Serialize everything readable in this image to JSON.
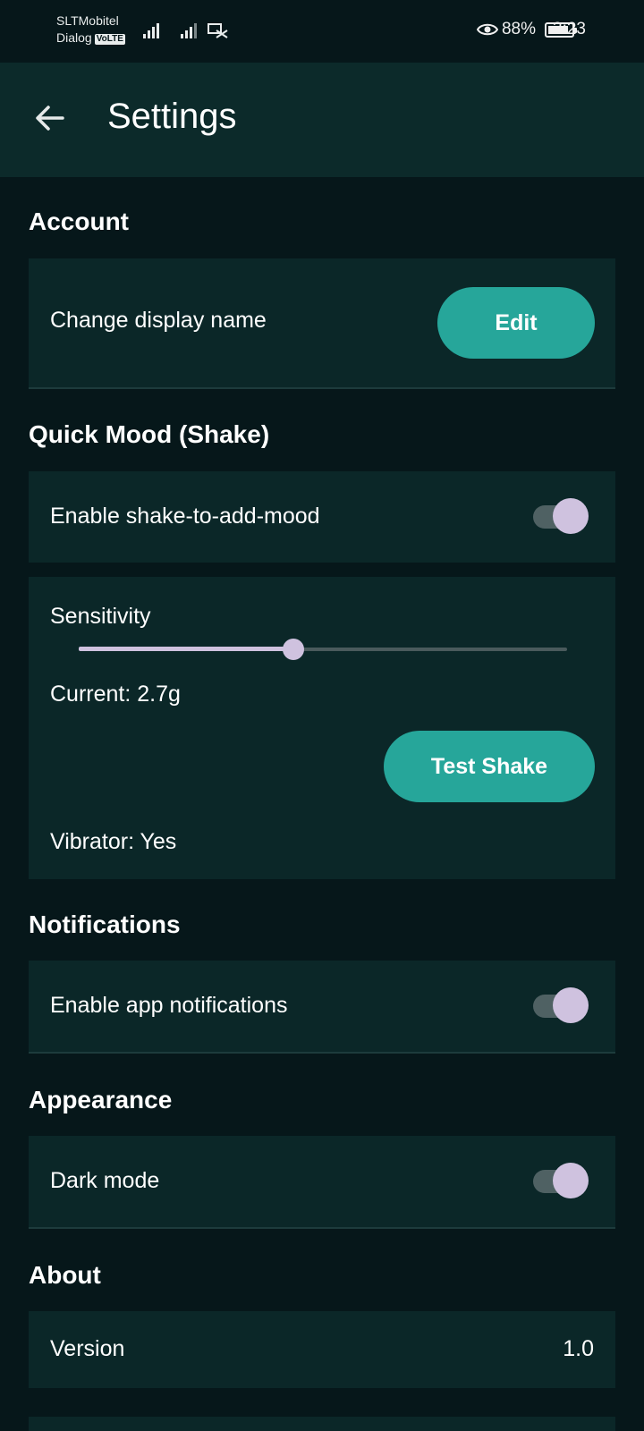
{
  "status_bar": {
    "carrier_1": "SLTMobitel",
    "carrier_2": "Dialog",
    "volte_badge": "VoLTE",
    "battery_percent": "88%",
    "battery_level": 0.88,
    "time": "3:23"
  },
  "app_bar": {
    "title": "Settings"
  },
  "sections": {
    "account": {
      "title": "Account",
      "change_name_label": "Change display name",
      "edit_button": "Edit"
    },
    "quick_mood": {
      "title": "Quick Mood (Shake)",
      "enable_label": "Enable shake-to-add-mood",
      "enable_on": true,
      "sensitivity_label": "Sensitivity",
      "sensitivity_fraction": 0.44,
      "current_text": "Current: 2.7g",
      "test_button": "Test Shake",
      "vibrator_text": "Vibrator: Yes"
    },
    "notifications": {
      "title": "Notifications",
      "enable_label": "Enable app notifications",
      "enable_on": true
    },
    "appearance": {
      "title": "Appearance",
      "dark_mode_label": "Dark mode",
      "dark_mode_on": true
    },
    "about": {
      "title": "About",
      "version_label": "Version",
      "version_value": "1.0"
    }
  },
  "colors": {
    "background": "#06171a",
    "app_bar": "#0c2a2a",
    "card": "#0b2728",
    "accent": "#26a69a",
    "toggle_knob": "#cfc2df"
  }
}
